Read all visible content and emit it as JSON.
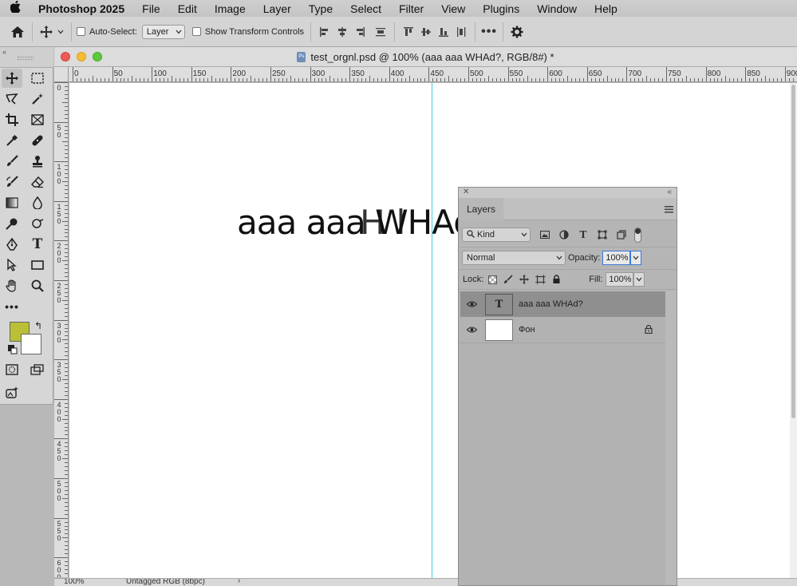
{
  "menubar": {
    "app_name": "Photoshop 2025",
    "items": [
      "File",
      "Edit",
      "Image",
      "Layer",
      "Type",
      "Select",
      "Filter",
      "View",
      "Plugins",
      "Window",
      "Help"
    ]
  },
  "options_bar": {
    "auto_select_label": "Auto-Select:",
    "auto_select_checked": false,
    "auto_select_target": "Layer",
    "show_transform_label": "Show Transform Controls",
    "show_transform_checked": false
  },
  "tools": {
    "foreground_color": "#bac035",
    "background_color": "#ffffff"
  },
  "document": {
    "title": "test_orgnl.psd @ 100% (aaa aaa WHAd?, RGB/8#) *",
    "canvas_text_a": "aaa aaa WHAd?",
    "canvas_text_b": "a Hl",
    "guide_color": "#38d3e0",
    "ruler_labels": [
      "0",
      "50",
      "100",
      "150",
      "200",
      "250",
      "300",
      "350",
      "400",
      "450",
      "500",
      "550",
      "600",
      "650",
      "700",
      "750",
      "800",
      "850",
      "900"
    ],
    "vruler_labels": [
      "0",
      "50",
      "100",
      "150",
      "200",
      "250",
      "300",
      "350",
      "400",
      "450",
      "500",
      "550",
      "600"
    ],
    "status_zoom": "100%",
    "status_profile": "Untagged RGB (8bpc)"
  },
  "layers_panel": {
    "tab_label": "Layers",
    "filter_kind": "Kind",
    "blend_mode": "Normal",
    "opacity_label": "Opacity:",
    "opacity_value": "100%",
    "lock_label": "Lock:",
    "fill_label": "Fill:",
    "fill_value": "100%",
    "layers": [
      {
        "name": "aaa aaa WHAd?",
        "thumb_glyph": "T",
        "selected": true,
        "locked": false
      },
      {
        "name": "Фон",
        "thumb_glyph": "",
        "selected": false,
        "locked": true
      }
    ]
  }
}
